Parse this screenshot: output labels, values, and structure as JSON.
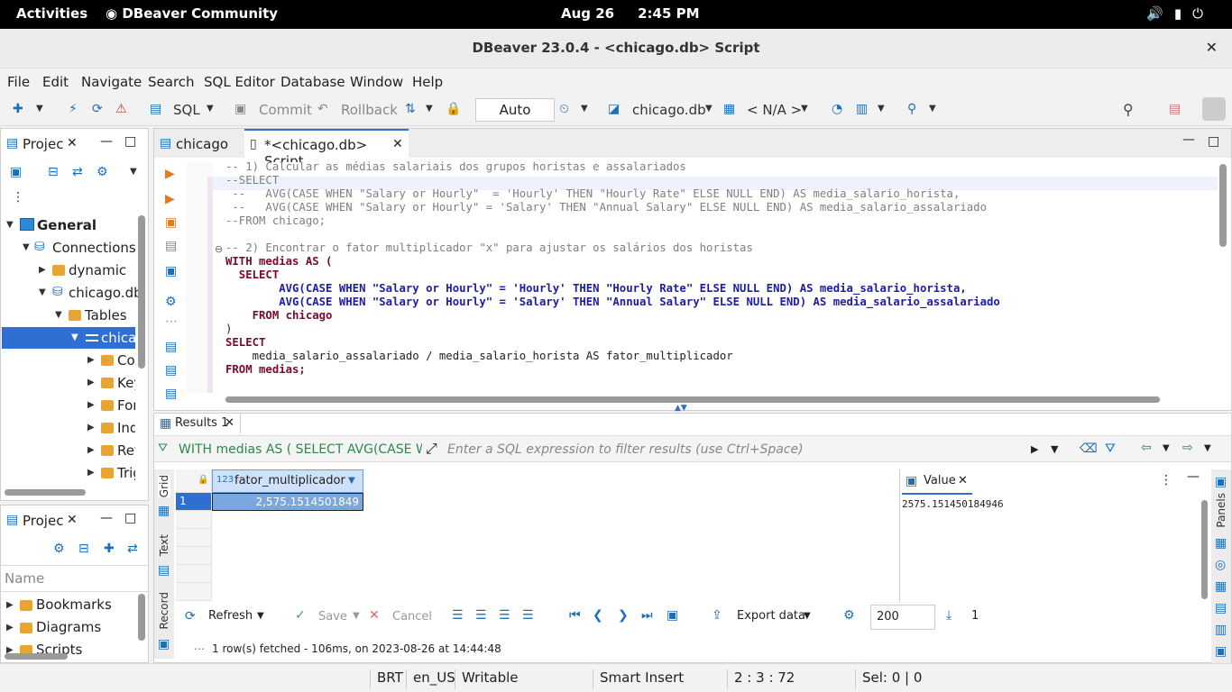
{
  "system": {
    "activities": "Activities",
    "app_name": "DBeaver Community",
    "date": "Aug 26",
    "time": "2:45 PM"
  },
  "window": {
    "title": "DBeaver 23.0.4 - <chicago.db> Script",
    "close": "✕"
  },
  "menu": [
    "File",
    "Edit",
    "Navigate",
    "Search",
    "SQL Editor",
    "Database",
    "Window",
    "Help"
  ],
  "toolbar": {
    "sql": "SQL",
    "commit": "Commit",
    "rollback": "Rollback",
    "mode": "Auto",
    "datasource": "chicago.db",
    "schema": "< N/A >"
  },
  "project_panel": {
    "tab": "Projec",
    "tree": [
      {
        "label": "General",
        "bold": true
      },
      {
        "label": "Connections"
      },
      {
        "label": "dynamic"
      },
      {
        "label": "chicago.db"
      },
      {
        "label": "Tables"
      },
      {
        "label": "chicago"
      },
      {
        "label": "Col"
      },
      {
        "label": "Key"
      },
      {
        "label": "For"
      },
      {
        "label": "Ind"
      },
      {
        "label": "Ref"
      },
      {
        "label": "Trig"
      }
    ]
  },
  "project_panel2": {
    "tab": "Projec",
    "name_header": "Name",
    "items": [
      "Bookmarks",
      "Diagrams",
      "Scripts"
    ]
  },
  "editor_tabs": [
    {
      "label": "chicago"
    },
    {
      "label": "*<chicago.db> Script"
    }
  ],
  "code_lines": [
    "-- 1) Calcular as médias salariais dos grupos horistas e assalariados",
    "--SELECT",
    " --   AVG(CASE WHEN \"Salary or Hourly\"  = 'Hourly' THEN \"Hourly Rate\" ELSE NULL END) AS media_salario_horista,",
    " --   AVG(CASE WHEN \"Salary or Hourly\" = 'Salary' THEN \"Annual Salary\" ELSE NULL END) AS media_salario_assalariado",
    "--FROM chicago;",
    "",
    "-- 2) Encontrar o fator multiplicador \"x\" para ajustar os salários dos horistas",
    "WITH medias AS (",
    "  SELECT",
    "        AVG(CASE WHEN \"Salary or Hourly\" = 'Hourly' THEN \"Hourly Rate\" ELSE NULL END) AS media_salario_horista,",
    "        AVG(CASE WHEN \"Salary or Hourly\" = 'Salary' THEN \"Annual Salary\" ELSE NULL END) AS media_salario_assalariado",
    "    FROM chicago",
    ")",
    "SELECT",
    "    media_salario_assalariado / media_salario_horista AS fator_multiplicador",
    "FROM medias;"
  ],
  "results": {
    "tab": "Results 1",
    "query_preview": "WITH medias AS ( SELECT AVG(CASE WH",
    "filter_placeholder": "Enter a SQL expression to filter results (use Ctrl+Space)",
    "column_type": "123",
    "column": "fator_multiplicador",
    "row_num": "1",
    "cell_value": "2,575.1514501849",
    "side_tabs": [
      "Grid",
      "Text",
      "Record"
    ],
    "value_panel_tab": "Value",
    "value_panel_text": "2575.151450184946",
    "panels_label": "Panels",
    "refresh": "Refresh",
    "save": "Save",
    "cancel": "Cancel",
    "export": "Export data",
    "fetch_size": "200",
    "row_count": "1",
    "fetch_status": "1 row(s) fetched - 106ms, on 2023-08-26 at 14:44:48"
  },
  "status": {
    "tz": "BRT",
    "locale": "en_US",
    "mode": "Writable",
    "insert": "Smart Insert",
    "pos": "2 : 3 : 72",
    "sel": "Sel: 0 | 0"
  }
}
